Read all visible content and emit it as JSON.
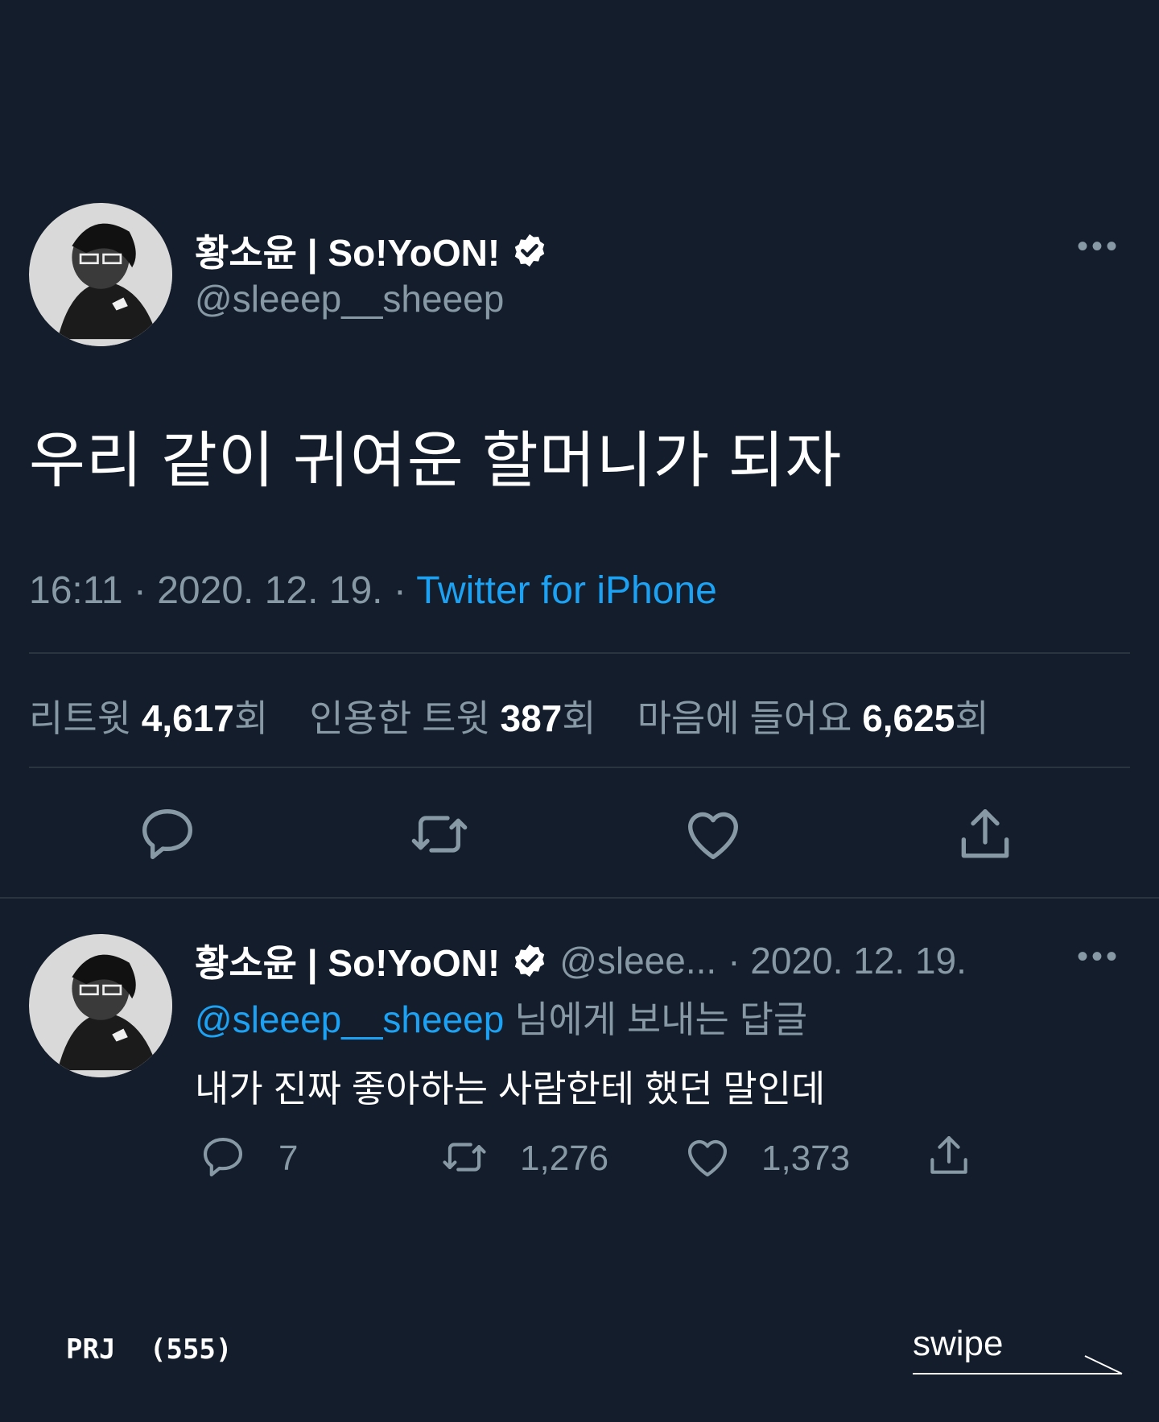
{
  "tweet": {
    "display_name": "황소윤 | So!YoON!",
    "handle": "@sleeep__sheeep",
    "more_label": "•••",
    "text": "우리 같이 귀여운 할머니가 되자",
    "time": "16:11",
    "date": "2020. 12. 19.",
    "source": "Twitter for iPhone",
    "separator": "·",
    "stats": {
      "retweets_label": "리트윗",
      "retweets_value": "4,617",
      "quotes_label": "인용한 트윗",
      "quotes_value": "387",
      "likes_label": "마음에 들어요",
      "likes_value": "6,625",
      "unit": "회"
    }
  },
  "reply": {
    "display_name": "황소윤 | So!YoON!",
    "handle_truncated": "@sleee...",
    "date": "· 2020. 12. 19.",
    "more_label": "•••",
    "reply_to_handle": "@sleeep__sheeep",
    "reply_to_suffix": "님에게 보내는 답글",
    "text": "내가 진짜 좋아하는 사람한테 했던 말인데",
    "reply_count": "7",
    "retweet_count": "1,276",
    "like_count": "1,373"
  },
  "footer": {
    "brand": "PRJ",
    "number": "(555)",
    "swipe": "swipe"
  },
  "icons": {
    "verified": "verified-badge-icon",
    "reply": "reply-bubble-icon",
    "retweet": "retweet-icon",
    "like": "heart-icon",
    "share": "share-icon",
    "arrow": "swipe-arrow-icon"
  },
  "colors": {
    "background": "#141d2b",
    "text": "#ffffff",
    "muted": "#8899a6",
    "link": "#1da1f2",
    "divider": "#2a3440"
  }
}
